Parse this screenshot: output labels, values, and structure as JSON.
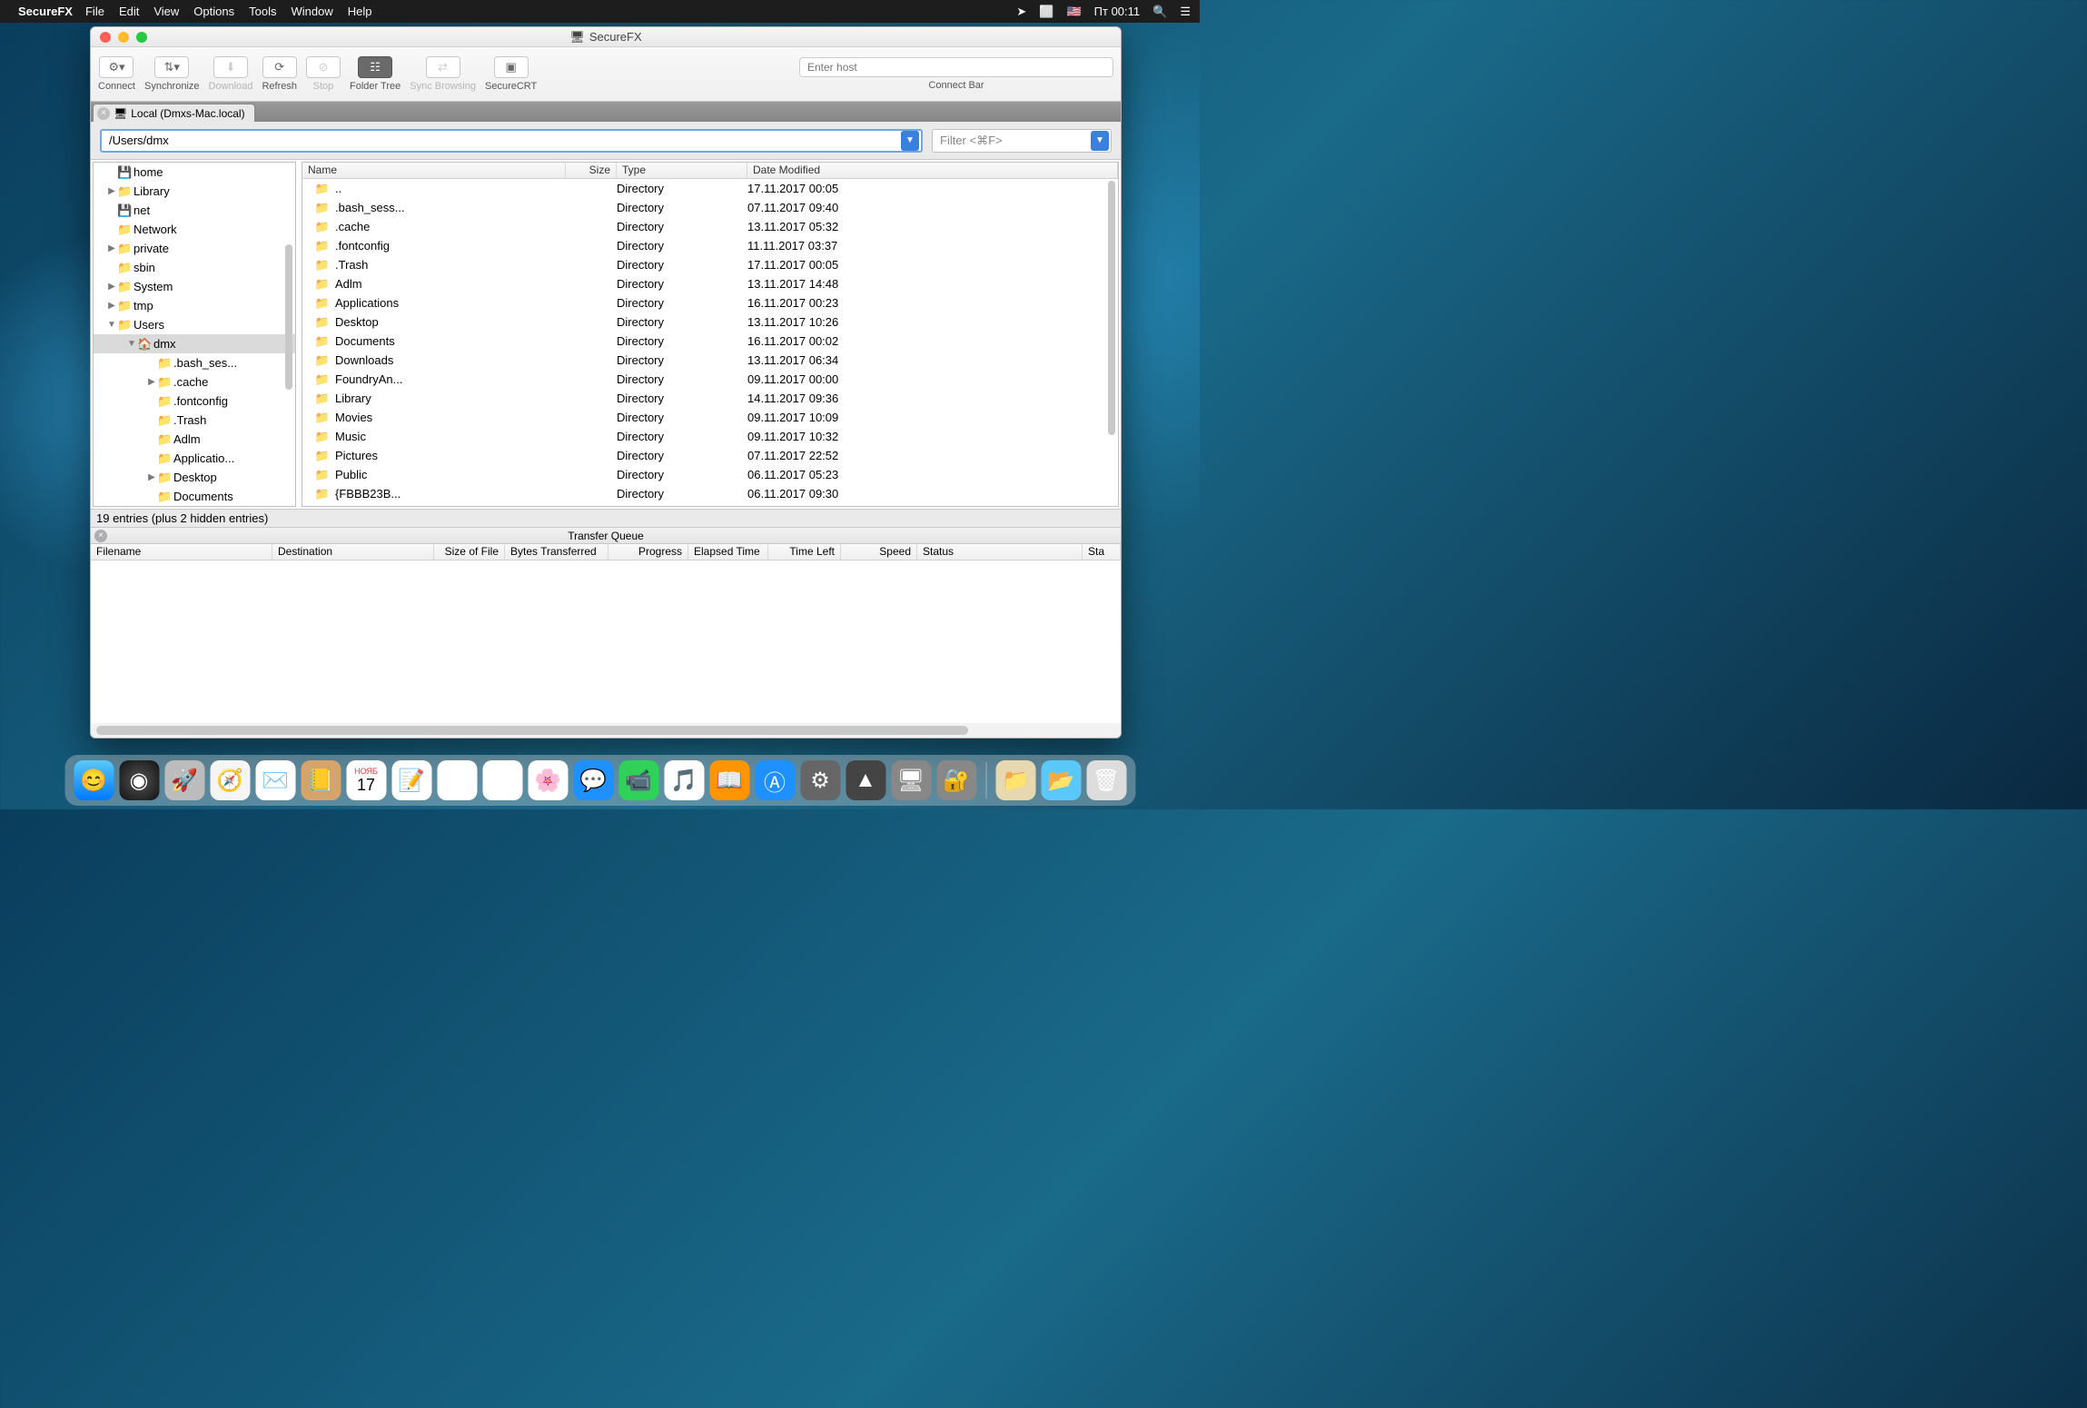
{
  "menubar": {
    "app": "SecureFX",
    "items": [
      "File",
      "Edit",
      "View",
      "Options",
      "Tools",
      "Window",
      "Help"
    ],
    "clock": "Пт 00:11"
  },
  "window": {
    "title": "SecureFX"
  },
  "toolbar": {
    "connect": "Connect",
    "synchronize": "Synchronize",
    "download": "Download",
    "refresh": "Refresh",
    "stop": "Stop",
    "folder_tree": "Folder Tree",
    "sync_browsing": "Sync Browsing",
    "securecrt": "SecureCRT",
    "host_placeholder": "Enter host",
    "connect_bar": "Connect Bar"
  },
  "tab": {
    "label": "Local (Dmxs-Mac.local)"
  },
  "path_value": "/Users/dmx",
  "filter_placeholder": "Filter <⌘F>",
  "tree": [
    {
      "indent": 0,
      "arrow": "",
      "icon": "drive",
      "label": "home"
    },
    {
      "indent": 0,
      "arrow": "▶",
      "icon": "folder",
      "label": "Library"
    },
    {
      "indent": 0,
      "arrow": "",
      "icon": "drive",
      "label": "net"
    },
    {
      "indent": 0,
      "arrow": "",
      "icon": "folder",
      "label": "Network"
    },
    {
      "indent": 0,
      "arrow": "▶",
      "icon": "folder",
      "label": "private"
    },
    {
      "indent": 0,
      "arrow": "",
      "icon": "folder",
      "label": "sbin"
    },
    {
      "indent": 0,
      "arrow": "▶",
      "icon": "x",
      "label": "System"
    },
    {
      "indent": 0,
      "arrow": "▶",
      "icon": "folder",
      "label": "tmp"
    },
    {
      "indent": 0,
      "arrow": "▼",
      "icon": "folder",
      "label": "Users"
    },
    {
      "indent": 1,
      "arrow": "▼",
      "icon": "home",
      "label": "dmx",
      "selected": true
    },
    {
      "indent": 2,
      "arrow": "",
      "icon": "folder",
      "label": ".bash_ses..."
    },
    {
      "indent": 2,
      "arrow": "▶",
      "icon": "folder",
      "label": ".cache"
    },
    {
      "indent": 2,
      "arrow": "",
      "icon": "folder",
      "label": ".fontconfig"
    },
    {
      "indent": 2,
      "arrow": "",
      "icon": "folder",
      "label": ".Trash"
    },
    {
      "indent": 2,
      "arrow": "",
      "icon": "folder",
      "label": "Adlm"
    },
    {
      "indent": 2,
      "arrow": "",
      "icon": "folder",
      "label": "Applicatio..."
    },
    {
      "indent": 2,
      "arrow": "▶",
      "icon": "folder",
      "label": "Desktop"
    },
    {
      "indent": 2,
      "arrow": "",
      "icon": "folder",
      "label": "Documents"
    }
  ],
  "file_columns": {
    "name": "Name",
    "size": "Size",
    "type": "Type",
    "date": "Date Modified"
  },
  "files": [
    {
      "name": "..",
      "type": "Directory",
      "date": "17.11.2017 00:05",
      "icon": "up"
    },
    {
      "name": ".bash_sess...",
      "type": "Directory",
      "date": "07.11.2017 09:40",
      "icon": "folder"
    },
    {
      "name": ".cache",
      "type": "Directory",
      "date": "13.11.2017 05:32",
      "icon": "folder"
    },
    {
      "name": ".fontconfig",
      "type": "Directory",
      "date": "11.11.2017 03:37",
      "icon": "folder"
    },
    {
      "name": ".Trash",
      "type": "Directory",
      "date": "17.11.2017 00:05",
      "icon": "folder"
    },
    {
      "name": "Adlm",
      "type": "Directory",
      "date": "13.11.2017 14:48",
      "icon": "folder"
    },
    {
      "name": "Applications",
      "type": "Directory",
      "date": "16.11.2017 00:23",
      "icon": "folder"
    },
    {
      "name": "Desktop",
      "type": "Directory",
      "date": "13.11.2017 10:26",
      "icon": "folder"
    },
    {
      "name": "Documents",
      "type": "Directory",
      "date": "16.11.2017 00:02",
      "icon": "folder"
    },
    {
      "name": "Downloads",
      "type": "Directory",
      "date": "13.11.2017 06:34",
      "icon": "folder"
    },
    {
      "name": "FoundryAn...",
      "type": "Directory",
      "date": "09.11.2017 00:00",
      "icon": "folder"
    },
    {
      "name": "Library",
      "type": "Directory",
      "date": "14.11.2017 09:36",
      "icon": "folder"
    },
    {
      "name": "Movies",
      "type": "Directory",
      "date": "09.11.2017 10:09",
      "icon": "folder"
    },
    {
      "name": "Music",
      "type": "Directory",
      "date": "09.11.2017 10:32",
      "icon": "folder"
    },
    {
      "name": "Pictures",
      "type": "Directory",
      "date": "07.11.2017 22:52",
      "icon": "folder"
    },
    {
      "name": "Public",
      "type": "Directory",
      "date": "06.11.2017 05:23",
      "icon": "folder"
    },
    {
      "name": "{FBBB23B...",
      "type": "Directory",
      "date": "06.11.2017 09:30",
      "icon": "folder"
    }
  ],
  "status": "19 entries (plus 2 hidden entries)",
  "transfer_queue": {
    "title": "Transfer Queue",
    "columns": [
      "Filename",
      "Destination",
      "Size of File",
      "Bytes Transferred",
      "Progress",
      "Elapsed Time",
      "Time Left",
      "Speed",
      "Status",
      "Sta"
    ]
  },
  "cal_month": "НОЯБ",
  "cal_day": "17"
}
